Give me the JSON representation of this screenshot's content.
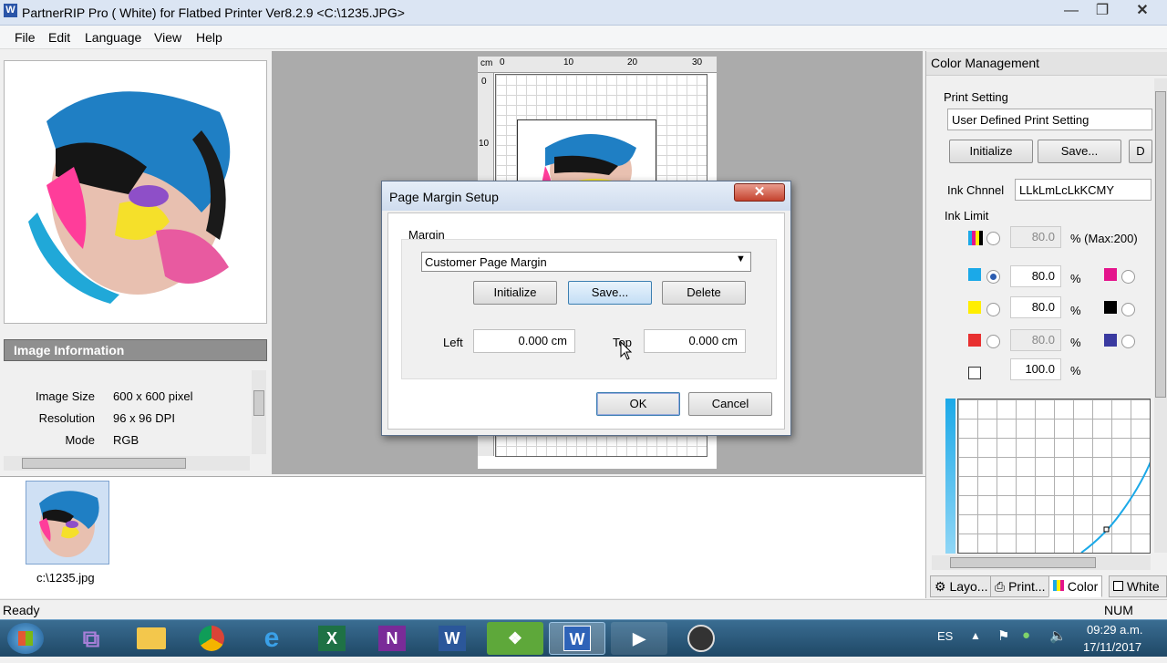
{
  "window": {
    "app_icon": "W",
    "title": "PartnerRIP Pro ( White) for Flatbed Printer Ver8.2.9 <C:\\1235.JPG>",
    "min_icon": "minimize-icon",
    "max_icon": "maximize-icon",
    "close_icon": "close-icon"
  },
  "menu": [
    "File",
    "Edit",
    "Language",
    "View",
    "Help"
  ],
  "left_panel": {
    "info_header": "Image Information",
    "rows": [
      {
        "label": "Image Size",
        "value": "600 x 600 pixel"
      },
      {
        "label": "Resolution",
        "value": "96 x 96 DPI"
      },
      {
        "label": "Mode",
        "value": "RGB"
      }
    ]
  },
  "canvas": {
    "ruler_unit": "cm",
    "ruler_top": [
      "0",
      "10",
      "20",
      "30"
    ],
    "ruler_left": [
      "0",
      "10"
    ]
  },
  "dialog": {
    "title": "Page Margin Setup",
    "group_label": "Margin",
    "preset": "Customer Page Margin",
    "initialize": "Initialize",
    "save": "Save...",
    "delete": "Delete",
    "left_label": "Left",
    "left_value": "0.000 cm",
    "top_label": "Top",
    "top_value": "0.000 cm",
    "ok": "OK",
    "cancel": "Cancel"
  },
  "right_panel": {
    "header": "Color Management",
    "print_setting_label": "Print Setting",
    "print_setting_value": "User Defined Print Setting",
    "initialize": "Initialize",
    "save": "Save...",
    "third_button": "D",
    "ink_channel_label": "Ink Chnnel",
    "ink_channel_value": "LLkLmLcLkKCMY",
    "ink_limit_label": "Ink Limit",
    "total_value": "80.0",
    "total_unit": "% (Max:200)",
    "inks": [
      {
        "color": "#1ba9e8",
        "value": "80.0",
        "unit": "%",
        "selected": true,
        "disabled": false
      },
      {
        "color": "#ffee00",
        "value": "80.0",
        "unit": "%",
        "selected": false,
        "disabled": false
      },
      {
        "color": "#e83030",
        "value": "80.0",
        "unit": "%",
        "selected": false,
        "disabled": true
      },
      {
        "color": "#ffffff",
        "value": "100.0",
        "unit": "%",
        "selected": false,
        "disabled": false
      }
    ],
    "inks_right": [
      "#e4148c",
      "#000000",
      "#3a3aa0"
    ]
  },
  "thumbnail": {
    "caption": "c:\\1235.jpg"
  },
  "tabs": [
    {
      "label": "Layo...",
      "icon": "layout-icon"
    },
    {
      "label": "Print...",
      "icon": "printer-icon"
    },
    {
      "label": "Color",
      "icon": "color-bars-icon"
    },
    {
      "label": "White",
      "icon": "white-box-icon"
    }
  ],
  "status": {
    "left": "Ready",
    "right": "NUM"
  },
  "taskbar": {
    "lang": "ES",
    "time": "09:29 a.m.",
    "date": "17/11/2017"
  }
}
